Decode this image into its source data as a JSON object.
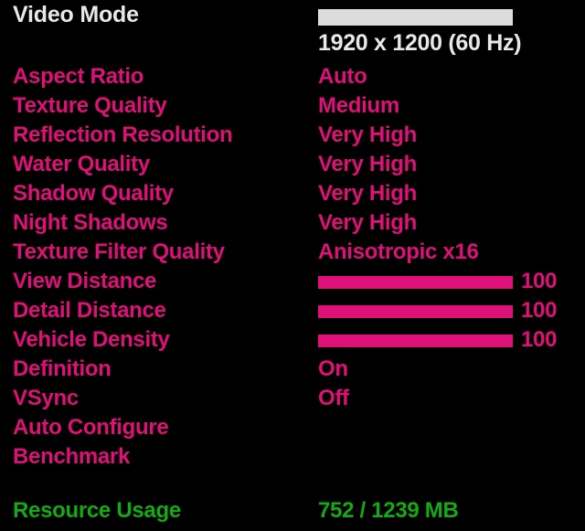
{
  "colors": {
    "background": "#000000",
    "title_text": "#e8e8e8",
    "option_text": "#dd1177",
    "slider_fill": "#dd1177",
    "resolution_bar": "#dcdcdc",
    "resource_text": "#13aa13"
  },
  "header": {
    "title": "Video Mode",
    "resolution": "1920 x 1200 (60 Hz)",
    "resolution_bar_percent": 100
  },
  "options": [
    {
      "label": "Aspect Ratio",
      "type": "select",
      "value": "Auto"
    },
    {
      "label": "Texture Quality",
      "type": "select",
      "value": "Medium"
    },
    {
      "label": "Reflection Resolution",
      "type": "select",
      "value": "Very High"
    },
    {
      "label": "Water Quality",
      "type": "select",
      "value": "Very High"
    },
    {
      "label": "Shadow Quality",
      "type": "select",
      "value": "Very High"
    },
    {
      "label": "Night Shadows",
      "type": "select",
      "value": "Very High"
    },
    {
      "label": "Texture Filter Quality",
      "type": "select",
      "value": "Anisotropic x16"
    },
    {
      "label": "View Distance",
      "type": "slider",
      "value": "100",
      "percent": 100
    },
    {
      "label": "Detail Distance",
      "type": "slider",
      "value": "100",
      "percent": 100
    },
    {
      "label": "Vehicle Density",
      "type": "slider",
      "value": "100",
      "percent": 100
    },
    {
      "label": "Definition",
      "type": "select",
      "value": "On"
    },
    {
      "label": "VSync",
      "type": "select",
      "value": "Off"
    },
    {
      "label": "Auto Configure",
      "type": "action",
      "value": ""
    },
    {
      "label": "Benchmark",
      "type": "action",
      "value": ""
    }
  ],
  "footer": {
    "label": "Resource Usage",
    "value": "752 / 1239 MB"
  }
}
